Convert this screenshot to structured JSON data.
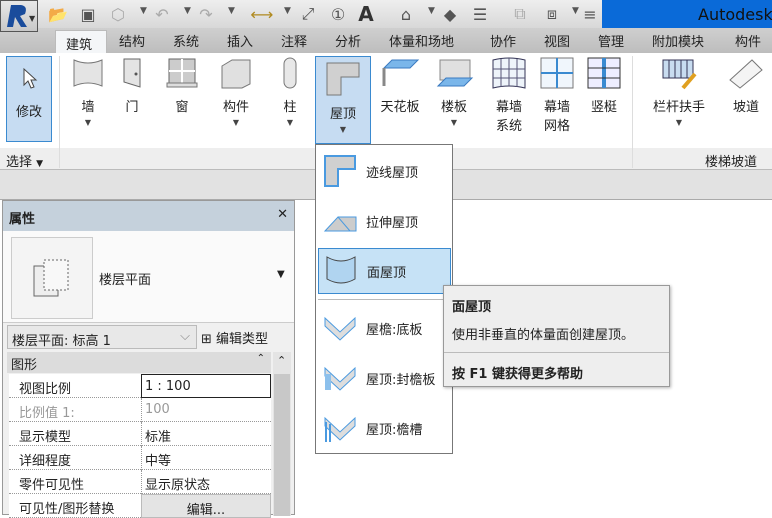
{
  "title": "Autodesk",
  "tabs": [
    "建筑",
    "结构",
    "系统",
    "插入",
    "注释",
    "分析",
    "体量和场地",
    "协作",
    "视图",
    "管理",
    "附加模块",
    "构件坞"
  ],
  "ribbon": {
    "modify": "修改",
    "wall": "墙",
    "door": "门",
    "window": "窗",
    "component": "构件",
    "column": "柱",
    "roof": "屋顶",
    "ceiling": "天花板",
    "floor": "楼板",
    "curtain_system": [
      "幕墙",
      "系统"
    ],
    "curtain_grid": [
      "幕墙",
      "网格"
    ],
    "mullion": "竖梃",
    "railing": "栏杆扶手",
    "ramp": "坡道",
    "panel_select": "选择",
    "panel_stairs": "楼梯坡道"
  },
  "roof_menu": [
    "迹线屋顶",
    "拉伸屋顶",
    "面屋顶",
    "屋檐:底板",
    "屋顶:封檐板",
    "屋顶:檐槽"
  ],
  "tooltip": {
    "title": "面屋顶",
    "desc": "使用非垂直的体量面创建屋顶。",
    "help": "按 F1 键获得更多帮助"
  },
  "properties": {
    "title": "属性",
    "close": "✕",
    "type_name": "楼层平面",
    "instance": "楼层平面: 标高 1",
    "edit_type": "编辑类型",
    "group": "图形",
    "rows": [
      {
        "k": "视图比例",
        "v": "1 : 100"
      },
      {
        "k": "比例值 1:",
        "v": "100"
      },
      {
        "k": "显示模型",
        "v": "标准"
      },
      {
        "k": "详细程度",
        "v": "中等"
      },
      {
        "k": "零件可见性",
        "v": "显示原状态"
      },
      {
        "k": "可见性/图形替换",
        "v": "编辑..."
      }
    ]
  }
}
